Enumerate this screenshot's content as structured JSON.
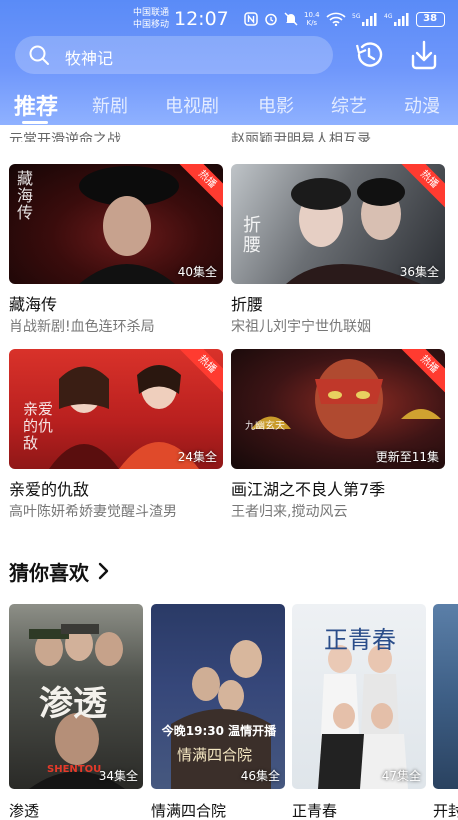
{
  "status_bar": {
    "carrier_1": "中国联通",
    "carrier_2": "中国移动",
    "time": "12:07",
    "speed_value": "10.4",
    "speed_unit": "K/s",
    "battery": "38"
  },
  "search": {
    "text": "牧神记"
  },
  "tabs": [
    {
      "label": "推荐",
      "active": true
    },
    {
      "label": "新剧"
    },
    {
      "label": "电视剧"
    },
    {
      "label": "电影"
    },
    {
      "label": "综艺"
    },
    {
      "label": "动漫"
    }
  ],
  "peek_row": {
    "left": "元常开滑逆命之战",
    "right": "赵丽颖尹明易人相互录"
  },
  "cards": [
    {
      "title": "藏海传",
      "subtitle": "肖战新剧!血色连环杀局",
      "episodes": "40集全",
      "badge": "热播",
      "poster_text": "藏海传"
    },
    {
      "title": "折腰",
      "subtitle": "宋祖儿刘宇宁世仇联姻",
      "episodes": "36集全",
      "badge": "热播",
      "poster_text": "折腰"
    },
    {
      "title": "亲爱的仇敌",
      "subtitle": "高叶陈妍希娇妻觉醒斗渣男",
      "episodes": "24集全",
      "badge": "热播",
      "poster_text": "亲爱的仇敌"
    },
    {
      "title": "画江湖之不良人第7季",
      "subtitle": "王者归来,搅动风云",
      "episodes": "更新至11集",
      "badge": "热播",
      "poster_text": "九幽玄天"
    }
  ],
  "guess_section": {
    "title": "猜你喜欢"
  },
  "guess_items": [
    {
      "title": "渗透",
      "episodes": "34集全",
      "poster_text": "渗透",
      "poster_text_2": "SHENTOU"
    },
    {
      "title": "情满四合院",
      "episodes": "46集全",
      "poster_text": "今晚19:30 温情开播",
      "poster_text_2": "情满四合院"
    },
    {
      "title": "正青春",
      "episodes": "47集全",
      "poster_text": "正青春"
    },
    {
      "title": "开封"
    }
  ],
  "colors": {
    "header_top": "#5a8bf7",
    "header_bottom": "#8fb1ff",
    "badge": "#ff3b30"
  }
}
